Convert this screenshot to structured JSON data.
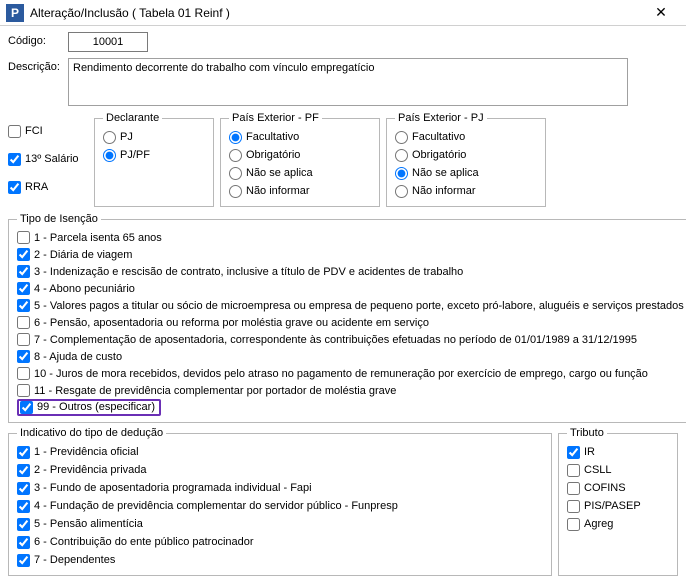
{
  "window": {
    "icon_letter": "P",
    "title": "Alteração/Inclusão ( Tabela 01 Reinf )",
    "close": "✕"
  },
  "form": {
    "codigo_label": "Código:",
    "codigo_value": "10001",
    "descricao_label": "Descrição:",
    "descricao_value": "Rendimento decorrente do trabalho com vínculo empregatício"
  },
  "flags": {
    "fci": "FCI",
    "decimo": "13º Salário",
    "rra": "RRA"
  },
  "declarante": {
    "legend": "Declarante",
    "pj": "PJ",
    "pjpf": "PJ/PF"
  },
  "pais_pf": {
    "legend": "País Exterior - PF",
    "facultativo": "Facultativo",
    "obrigatorio": "Obrigatório",
    "nao_aplica": "Não se aplica",
    "nao_informar": "Não informar"
  },
  "pais_pj": {
    "legend": "País Exterior - PJ",
    "facultativo": "Facultativo",
    "obrigatorio": "Obrigatório",
    "nao_aplica": "Não se aplica",
    "nao_informar": "Não informar"
  },
  "isencao": {
    "legend": "Tipo de Isenção",
    "i1": "1 - Parcela isenta 65 anos",
    "i2": "2 - Diária de viagem",
    "i3": "3 - Indenização e rescisão de contrato, inclusive a título de PDV e acidentes de trabalho",
    "i4": "4 - Abono pecuniário",
    "i5": "5 - Valores pagos a titular ou sócio de microempresa ou empresa de pequeno porte, exceto pró-labore, aluguéis e serviços prestados",
    "i6": "6 - Pensão, aposentadoria ou reforma por moléstia grave ou acidente em serviço",
    "i7": "7 - Complementação de aposentadoria, correspondente às contribuições efetuadas no período de 01/01/1989 a 31/12/1995",
    "i8": "8 - Ajuda de custo",
    "i10": "10 - Juros de mora recebidos, devidos pelo atraso no pagamento de remuneração por exercício de emprego, cargo ou função",
    "i11": "11 - Resgate de previdência complementar por portador de moléstia grave",
    "i99": "99 - Outros (especificar)"
  },
  "indicativo": {
    "legend": "Indicativo do tipo de dedução",
    "d1": "1 - Previdência oficial",
    "d2": "2 - Previdência privada",
    "d3": "3 - Fundo de aposentadoria programada individual - Fapi",
    "d4": "4 - Fundação de previdência complementar do servidor público - Funpresp",
    "d5": "5 - Pensão alimentícia",
    "d6": "6 - Contribuição do ente público patrocinador",
    "d7": "7 - Dependentes"
  },
  "tributo": {
    "legend": "Tributo",
    "ir": "IR",
    "csll": "CSLL",
    "cofins": "COFINS",
    "pis": "PIS/PASEP",
    "agreg": "Agreg"
  }
}
